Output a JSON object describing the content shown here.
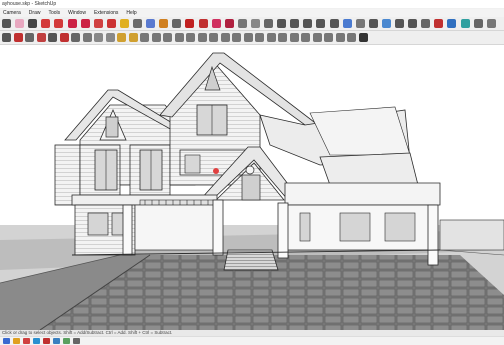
{
  "window": {
    "title": "ayhouse.skp - SketchUp"
  },
  "menu": {
    "items": [
      "Camera",
      "Draw",
      "Tools",
      "Window",
      "Extensions",
      "Help"
    ]
  },
  "toolbar1": {
    "tools": [
      {
        "name": "select-icon",
        "color": "#555555"
      },
      {
        "name": "eraser-icon",
        "color": "#e8a8c0"
      },
      {
        "name": "line-icon",
        "color": "#444444"
      },
      {
        "name": "arc-icon",
        "color": "#d33a3a"
      },
      {
        "name": "rectangle-icon",
        "color": "#d33a3a"
      },
      {
        "name": "push-pull-icon",
        "color": "#cc2244"
      },
      {
        "name": "move-icon",
        "color": "#cc2244"
      },
      {
        "name": "rotate-icon",
        "color": "#d04040"
      },
      {
        "name": "scale-icon",
        "color": "#c33"
      },
      {
        "name": "tape-measure-icon",
        "color": "#e0b020"
      },
      {
        "name": "paint-bucket-icon",
        "color": "#6a6a6a"
      },
      {
        "name": "orbit-icon",
        "color": "#5a7ad0"
      },
      {
        "name": "pan-icon",
        "color": "#d08020"
      },
      {
        "name": "zoom-icon",
        "color": "#666666"
      },
      {
        "name": "zoom-extents-icon",
        "color": "#c02020"
      },
      {
        "name": "walk-icon",
        "color": "#c03030"
      },
      {
        "name": "camera-icon",
        "color": "#d03060"
      },
      {
        "name": "look-around-icon",
        "color": "#b02040"
      },
      {
        "name": "section-plane-icon",
        "color": "#777777"
      },
      {
        "name": "components-icon",
        "color": "#888888"
      },
      {
        "name": "iso-view-icon",
        "color": "#666666"
      },
      {
        "name": "top-view-icon",
        "color": "#555555"
      },
      {
        "name": "front-view-icon",
        "color": "#555555"
      },
      {
        "name": "right-view-icon",
        "color": "#555555"
      },
      {
        "name": "back-view-icon",
        "color": "#555555"
      },
      {
        "name": "left-view-icon",
        "color": "#555555"
      },
      {
        "name": "xray-icon",
        "color": "#4a7ad0"
      },
      {
        "name": "wireframe-icon",
        "color": "#777777"
      },
      {
        "name": "hidden-line-icon",
        "color": "#555555"
      },
      {
        "name": "shaded-icon",
        "color": "#4a88d0"
      },
      {
        "name": "textured-icon",
        "color": "#555555"
      },
      {
        "name": "monochrome-icon",
        "color": "#555555"
      },
      {
        "name": "warehouse-icon",
        "color": "#666666"
      },
      {
        "name": "extension-warehouse-icon",
        "color": "#c03030"
      },
      {
        "name": "layout-icon",
        "color": "#3070c0"
      },
      {
        "name": "style-builder-icon",
        "color": "#30a0a0"
      },
      {
        "name": "shadow-icon",
        "color": "#666666"
      },
      {
        "name": "fog-icon",
        "color": "#777777"
      }
    ]
  },
  "toolbar2": {
    "tools": [
      {
        "name": "offset-icon",
        "color": "#555555"
      },
      {
        "name": "follow-me-icon",
        "color": "#c03030"
      },
      {
        "name": "text-icon",
        "color": "#666666"
      },
      {
        "name": "axes-icon",
        "color": "#c04040"
      },
      {
        "name": "dimension-icon",
        "color": "#555555"
      },
      {
        "name": "protractor-icon",
        "color": "#c03030"
      },
      {
        "name": "3d-text-icon",
        "color": "#666666"
      },
      {
        "name": "window-icon",
        "color": "#777777"
      },
      {
        "name": "solid-union-icon",
        "color": "#888888"
      },
      {
        "name": "solid-subtract-icon",
        "color": "#888888"
      },
      {
        "name": "sandbox-icon",
        "color": "#d0a030"
      },
      {
        "name": "smoove-icon",
        "color": "#d0a030"
      },
      {
        "name": "stamp-icon",
        "color": "#777777"
      },
      {
        "name": "drape-icon",
        "color": "#777777"
      },
      {
        "name": "flip-icon",
        "color": "#777777"
      },
      {
        "name": "soften-icon",
        "color": "#777777"
      },
      {
        "name": "hide-icon",
        "color": "#777777"
      },
      {
        "name": "unhide-icon",
        "color": "#777777"
      },
      {
        "name": "group-icon",
        "color": "#777777"
      },
      {
        "name": "explode-icon",
        "color": "#777777"
      },
      {
        "name": "outliner-icon",
        "color": "#777777"
      },
      {
        "name": "layers-icon",
        "color": "#777777"
      },
      {
        "name": "scenes-icon",
        "color": "#777777"
      },
      {
        "name": "materials-icon",
        "color": "#777777"
      },
      {
        "name": "entity-info-icon",
        "color": "#777777"
      },
      {
        "name": "instructor-icon",
        "color": "#777777"
      },
      {
        "name": "add-location-icon",
        "color": "#777777"
      },
      {
        "name": "preview-icon",
        "color": "#777777"
      },
      {
        "name": "dynamic-component-icon",
        "color": "#777777"
      },
      {
        "name": "sun-settings-icon",
        "color": "#777777"
      },
      {
        "name": "section-fill-icon",
        "color": "#777777"
      },
      {
        "name": "extension-manager-icon",
        "color": "#333333"
      }
    ]
  },
  "status": {
    "text": "Click or drag to select objects. Shift = Add/Subtract. Ctrl = Add. Shift + Ctrl = Subtract."
  },
  "taskbar": {
    "icons": [
      {
        "name": "start-icon",
        "color": "#3a6ad0"
      },
      {
        "name": "file-explorer-icon",
        "color": "#e0a020"
      },
      {
        "name": "chrome-icon",
        "color": "#d04040"
      },
      {
        "name": "edge-icon",
        "color": "#2a90d0"
      },
      {
        "name": "sketchup-icon",
        "color": "#c03030"
      },
      {
        "name": "mail-icon",
        "color": "#3a80c0"
      },
      {
        "name": "photos-icon",
        "color": "#5aa060"
      },
      {
        "name": "settings-icon",
        "color": "#666666"
      }
    ]
  },
  "colors": {
    "roof": "#e2e2e2",
    "wall": "#f2f2f2",
    "outline": "#2a2a2a",
    "pavers": "#777777",
    "ground": "#cfcfcf"
  }
}
